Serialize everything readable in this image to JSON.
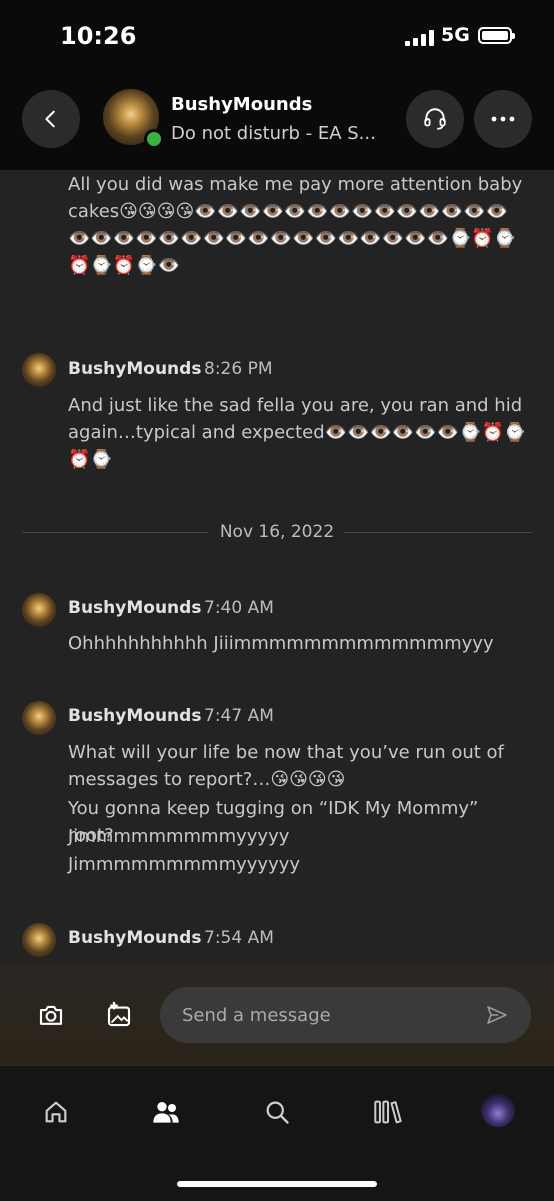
{
  "status": {
    "time": "10:26",
    "network": "5G"
  },
  "header": {
    "contact_name": "BushyMounds",
    "contact_status": "Do not disturb - EA S..."
  },
  "messages": {
    "m1": {
      "text": "All you did was make me pay more attention baby cakes😘😘😘😘👁️👁️👁️👁️👁️👁️👁️👁️👁️👁️👁️👁️👁️👁️👁️👁️👁️👁️👁️👁️👁️👁️👁️👁️👁️👁️👁️👁️👁️👁️👁️⌚⏰⌚⏰⌚⏰⌚👁️"
    },
    "m2": {
      "sender": "BushyMounds",
      "time": "8:26 PM",
      "text": "And just like the sad fella you are, you ran and hid again…typical and expected👁️👁️👁️👁️👁️👁️⌚⏰⌚⏰⌚"
    },
    "date_divider": "Nov 16, 2022",
    "m3": {
      "sender": "BushyMounds",
      "time": "7:40 AM",
      "text": "Ohhhhhhhhhhh Jiiimmmmmmmmmmmmmyyy"
    },
    "m4": {
      "sender": "BushyMounds",
      "time": "7:47 AM",
      "line1": "What will your life be now that you’ve run out of messages to report?…😘😘😘😘",
      "line2": "You gonna keep tugging on “IDK My Mommy” root?",
      "line3": "Jimmmmmmmmmyyyyy",
      "line4": "Jimmmmmmmmmyyyyyy"
    },
    "m5": {
      "sender": "BushyMounds",
      "time": "7:54 AM"
    }
  },
  "composer": {
    "placeholder": "Send a message"
  },
  "colors": {
    "background": "#232323",
    "header": "#0a0a0a",
    "presence": "#3cb043"
  }
}
